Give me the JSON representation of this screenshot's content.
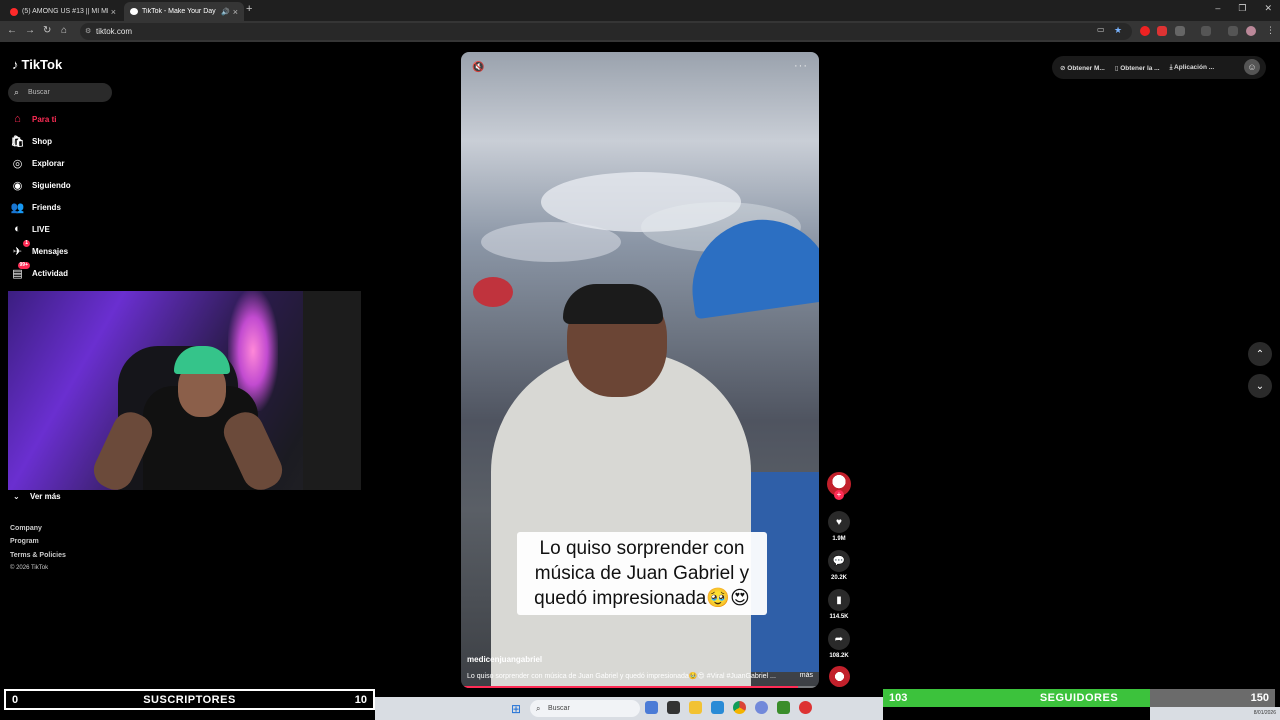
{
  "browser": {
    "tabs": [
      {
        "title": "(5) AMONG US #13 || MI MEJO",
        "favicon_color": "#ff2a2a"
      },
      {
        "title": "TikTok - Make Your Day",
        "favicon_color": "#ffffff"
      }
    ],
    "url": "tiktok.com"
  },
  "sidebar": {
    "logo": "TikTok",
    "search_placeholder": "Buscar",
    "items": [
      {
        "label": "Para ti",
        "icon": "home-icon",
        "glyph": "⌂",
        "active": true
      },
      {
        "label": "Shop",
        "icon": "shop-icon",
        "glyph": "🛍"
      },
      {
        "label": "Explorar",
        "icon": "compass-icon",
        "glyph": "◎"
      },
      {
        "label": "Siguiendo",
        "icon": "following-icon",
        "glyph": "◉"
      },
      {
        "label": "Friends",
        "icon": "friends-icon",
        "glyph": "👥"
      },
      {
        "label": "LIVE",
        "icon": "live-icon",
        "glyph": "◐"
      },
      {
        "label": "Mensajes",
        "icon": "messages-icon",
        "glyph": "✈",
        "badge": "1"
      },
      {
        "label": "Actividad",
        "icon": "activity-icon",
        "glyph": "▤",
        "badge": "99+"
      }
    ],
    "see_more": "Ver más",
    "footer": {
      "links": [
        "Company",
        "Program",
        "Terms & Policies"
      ],
      "copyright": "© 2026 TikTok"
    }
  },
  "video": {
    "caption_overlay": "Lo quiso sorprender con música de Juan Gabriel y quedó impresionada🥹😍",
    "author": "medicenjuangabriel",
    "description": "Lo quiso sorprender con música de Juan Gabriel y quedó impresionada🥹😍 #Viral #JuanGabriel ...",
    "more_label": "más",
    "progress": 0.94
  },
  "actions": {
    "likes": "1.9M",
    "comments": "20.2K",
    "saves": "114.5K",
    "shares": "108.2K"
  },
  "top_right": {
    "buttons": [
      "Obtener M...",
      "Obtener la ...",
      "Aplicación ..."
    ]
  },
  "stream_overlay": {
    "subscribers": {
      "current": "0",
      "label": "SUSCRIPTORES",
      "goal": "10"
    },
    "followers": {
      "current": "103",
      "label": "SEGUIDORES",
      "goal": "150",
      "progress": 0.68
    }
  },
  "taskbar": {
    "search_placeholder": "Buscar",
    "clock": "8/01/2026"
  }
}
